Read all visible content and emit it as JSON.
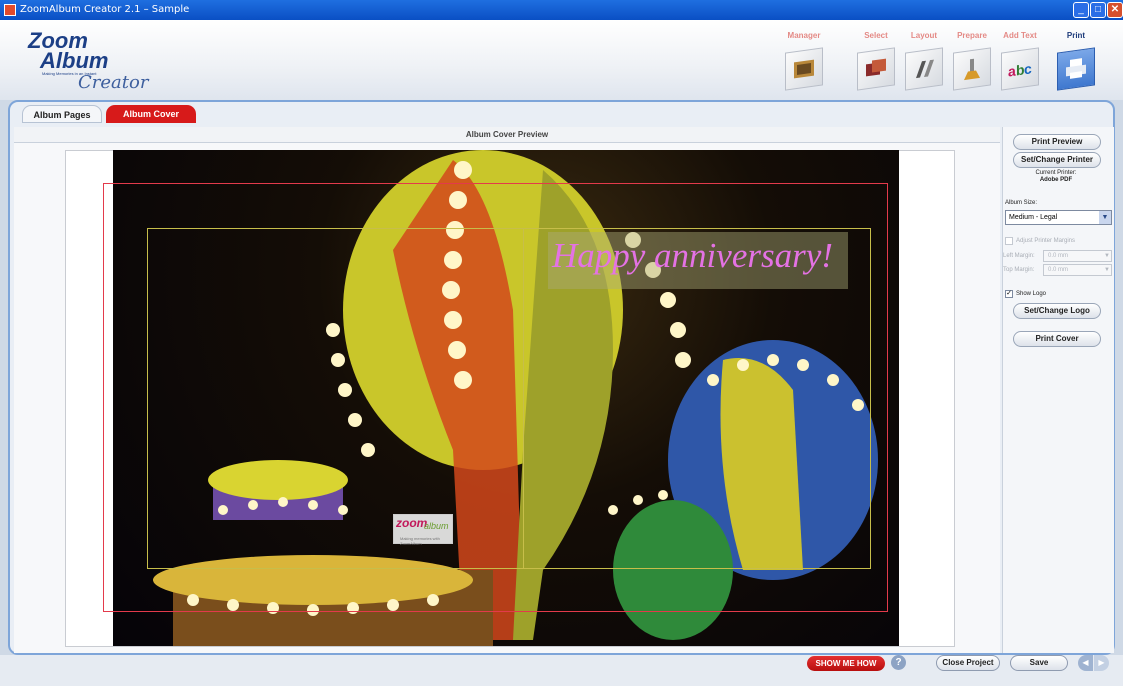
{
  "window": {
    "title": "ZoomAlbum Creator 2.1 – Sample"
  },
  "logo": {
    "line1": "Zoom",
    "line2": "Album",
    "tagline": "Making Memories in an Instant",
    "product": "Creator"
  },
  "steps": [
    {
      "label": "Manager",
      "icon": "manager-icon"
    },
    {
      "label": "Select",
      "icon": "select-icon"
    },
    {
      "label": "Layout",
      "icon": "layout-icon"
    },
    {
      "label": "Prepare",
      "icon": "prepare-icon"
    },
    {
      "label": "Add Text",
      "icon": "add-text-icon"
    },
    {
      "label": "Print",
      "icon": "print-icon",
      "active": true
    }
  ],
  "tabs": {
    "pages": "Album Pages",
    "cover": "Album Cover"
  },
  "preview": {
    "title": "Album Cover Preview",
    "caption": "Happy anniversary!",
    "logo_text_1": "zoom",
    "logo_text_2": "album",
    "logo_tagline": "Making memories with ZoomAlbum"
  },
  "sidebar": {
    "print_preview": "Print Preview",
    "set_change_printer": "Set/Change Printer",
    "current_printer_label": "Current Printer:",
    "current_printer": "Adobe PDF",
    "album_size_label": "Album Size:",
    "album_size": "Medium - Legal",
    "adjust_margins_label": "Adjust Printer Margins",
    "left_margin_label": "Left Margin:",
    "left_margin": "0.0 mm",
    "top_margin_label": "Top Margin:",
    "top_margin": "0.0 mm",
    "show_logo_label": "Show Logo",
    "show_logo_checked": true,
    "set_change_logo": "Set/Change Logo",
    "print_cover": "Print Cover"
  },
  "bottom": {
    "show_me_how": "SHOW ME HOW",
    "help": "?",
    "close_project": "Close Project",
    "save": "Save"
  },
  "colors": {
    "active_tab": "#d71a1a",
    "caption": "#e472e4",
    "accent": "#7ea5d9"
  }
}
